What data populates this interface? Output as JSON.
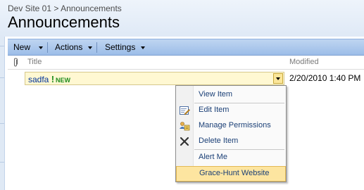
{
  "breadcrumb": {
    "site": "Dev Site 01",
    "separator": ">",
    "current": "Announcements"
  },
  "page_title": "Announcements",
  "toolbar": {
    "new_label": "New",
    "actions_label": "Actions",
    "settings_label": "Settings"
  },
  "columns": {
    "attachment_icon": "paperclip-icon",
    "title": "Title",
    "modified": "Modified"
  },
  "item": {
    "title": "sadfa",
    "new_mark": "!",
    "new_badge": "NEW",
    "modified": "2/20/2010 1:40 PM"
  },
  "context_menu": {
    "items": [
      {
        "label": "View Item",
        "icon": ""
      },
      {
        "label": "Edit Item",
        "icon": "edit-icon"
      },
      {
        "label": "Manage Permissions",
        "icon": "permissions-icon"
      },
      {
        "label": "Delete Item",
        "icon": "delete-icon"
      },
      {
        "label": "Alert Me",
        "icon": ""
      },
      {
        "label": "Grace-Hunt Website",
        "icon": ""
      }
    ]
  },
  "colors": {
    "accent": "#1a3f76",
    "toolbar": "#9cbde8",
    "highlight": "#fde5a0",
    "new_badge": "#1e8c1e"
  }
}
